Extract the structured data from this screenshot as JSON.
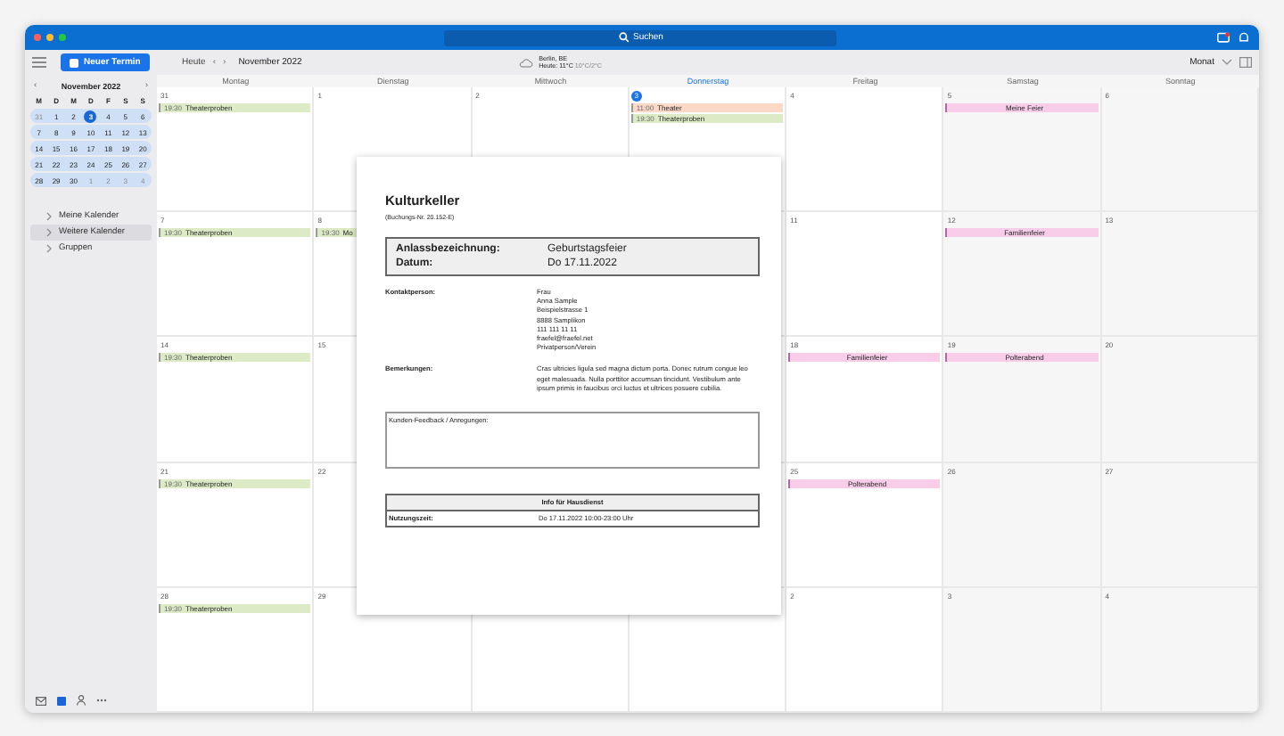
{
  "window": {
    "search": {
      "placeholder": "Suchen"
    }
  },
  "toolbar": {
    "new_button": "Neuer Termin",
    "today": "Heute",
    "prev": "‹",
    "next": "›",
    "period": "November 2022",
    "weather": {
      "city": "Berlin, BE",
      "today": "Heute: 11°C",
      "range": "10°C/2°C"
    },
    "view": "Monat"
  },
  "mini_calendar": {
    "title": "November 2022",
    "prev": "‹",
    "next": "›",
    "weekdays": [
      "M",
      "D",
      "M",
      "D",
      "F",
      "S",
      "S"
    ],
    "weeks": [
      [
        {
          "day": "31",
          "other": true,
          "selected": false
        },
        {
          "day": "1",
          "other": false,
          "selected": false
        },
        {
          "day": "2",
          "other": false,
          "selected": false
        },
        {
          "day": "3",
          "other": false,
          "selected": true
        },
        {
          "day": "4",
          "other": false,
          "selected": false
        },
        {
          "day": "5",
          "other": false,
          "selected": false
        },
        {
          "day": "6",
          "other": false,
          "selected": false
        }
      ],
      [
        {
          "day": "7",
          "other": false,
          "selected": false
        },
        {
          "day": "8",
          "other": false,
          "selected": false
        },
        {
          "day": "9",
          "other": false,
          "selected": false
        },
        {
          "day": "10",
          "other": false,
          "selected": false
        },
        {
          "day": "11",
          "other": false,
          "selected": false
        },
        {
          "day": "12",
          "other": false,
          "selected": false
        },
        {
          "day": "13",
          "other": false,
          "selected": false
        }
      ],
      [
        {
          "day": "14",
          "other": false,
          "selected": false
        },
        {
          "day": "15",
          "other": false,
          "selected": false
        },
        {
          "day": "16",
          "other": false,
          "selected": false
        },
        {
          "day": "17",
          "other": false,
          "selected": false
        },
        {
          "day": "18",
          "other": false,
          "selected": false
        },
        {
          "day": "19",
          "other": false,
          "selected": false
        },
        {
          "day": "20",
          "other": false,
          "selected": false
        }
      ],
      [
        {
          "day": "21",
          "other": false,
          "selected": false
        },
        {
          "day": "22",
          "other": false,
          "selected": false
        },
        {
          "day": "23",
          "other": false,
          "selected": false
        },
        {
          "day": "24",
          "other": false,
          "selected": false
        },
        {
          "day": "25",
          "other": false,
          "selected": false
        },
        {
          "day": "26",
          "other": false,
          "selected": false
        },
        {
          "day": "27",
          "other": false,
          "selected": false
        }
      ],
      [
        {
          "day": "28",
          "other": false,
          "selected": false
        },
        {
          "day": "29",
          "other": false,
          "selected": false
        },
        {
          "day": "30",
          "other": false,
          "selected": false
        },
        {
          "day": "1",
          "other": true,
          "selected": false
        },
        {
          "day": "2",
          "other": true,
          "selected": false
        },
        {
          "day": "3",
          "other": true,
          "selected": false
        },
        {
          "day": "4",
          "other": true,
          "selected": false
        }
      ]
    ]
  },
  "sidebar": {
    "items": [
      {
        "label": "Meine Kalender",
        "selected": false
      },
      {
        "label": "Weitere Kalender",
        "selected": true
      },
      {
        "label": "Gruppen",
        "selected": false
      }
    ]
  },
  "calendar": {
    "weekdays": [
      {
        "label": "Montag",
        "today": false
      },
      {
        "label": "Dienstag",
        "today": false
      },
      {
        "label": "Mittwoch",
        "today": false
      },
      {
        "label": "Donnerstag",
        "today": true
      },
      {
        "label": "Freitag",
        "today": false
      },
      {
        "label": "Samstag",
        "today": false
      },
      {
        "label": "Sonntag",
        "today": false
      }
    ],
    "weeks": [
      [
        {
          "day": "31",
          "today": false,
          "events": [
            {
              "kind": "timed",
              "time": "19:30",
              "title": "Theaterproben",
              "color": "#dcebc6"
            }
          ]
        },
        {
          "day": "1",
          "today": false
        },
        {
          "day": "2",
          "today": false
        },
        {
          "day": "3",
          "today": true,
          "events": [
            {
              "kind": "timed",
              "time": "11:00",
              "title": "Theater",
              "color": "#fbd9c6"
            },
            {
              "kind": "timed",
              "time": "19:30",
              "title": "Theaterproben",
              "color": "#dcebc6"
            }
          ]
        },
        {
          "day": "4",
          "today": false
        },
        {
          "day": "5",
          "today": false,
          "events": [
            {
              "kind": "allday",
              "title": "Meine Feier",
              "color": "#f7cde9"
            }
          ]
        },
        {
          "day": "6",
          "today": false
        }
      ],
      [
        {
          "day": "7",
          "today": false,
          "events": [
            {
              "kind": "timed",
              "time": "19:30",
              "title": "Theaterproben",
              "color": "#dcebc6"
            }
          ]
        },
        {
          "day": "8",
          "today": false,
          "events": [
            {
              "kind": "timed",
              "time": "19:30",
              "title": "Mo",
              "color": "#dcebc6"
            }
          ]
        },
        {
          "day": "11",
          "today": false
        },
        {
          "day": "12",
          "today": false,
          "events": [
            {
              "kind": "allday",
              "title": "Familienfeier",
              "color": "#f7cde9"
            }
          ]
        },
        {
          "day": "13",
          "today": false
        }
      ],
      [
        {
          "day": "14",
          "today": false,
          "events": [
            {
              "kind": "timed",
              "time": "19:30",
              "title": "Theaterproben",
              "color": "#dcebc6"
            }
          ]
        },
        {
          "day": "15",
          "today": false
        },
        {
          "day": "18",
          "today": false,
          "events": [
            {
              "kind": "allday",
              "title": "Familienfeier",
              "color": "#f7cde9"
            }
          ]
        },
        {
          "day": "19",
          "today": false,
          "events": [
            {
              "kind": "allday",
              "title": "Polterabend",
              "color": "#f7cde9"
            }
          ]
        },
        {
          "day": "20",
          "today": false
        }
      ],
      [
        {
          "day": "21",
          "today": false,
          "events": [
            {
              "kind": "timed",
              "time": "19:30",
              "title": "Theaterproben",
              "color": "#dcebc6"
            }
          ]
        },
        {
          "day": "22",
          "today": false
        },
        {
          "day": "25",
          "today": false,
          "events": [
            {
              "kind": "allday",
              "title": "Polterabend",
              "color": "#f7cde9"
            }
          ]
        },
        {
          "day": "26",
          "today": false
        },
        {
          "day": "27",
          "today": false
        }
      ],
      [
        {
          "day": "28",
          "today": false,
          "events": [
            {
              "kind": "timed",
              "time": "19:30",
              "title": "Theaterproben",
              "color": "#dcebc6"
            }
          ]
        },
        {
          "day": "29",
          "today": false
        },
        {
          "day": "2",
          "today": false
        },
        {
          "day": "3",
          "today": false
        },
        {
          "day": "4",
          "today": false
        }
      ]
    ]
  },
  "document": {
    "title": "Kulturkeller",
    "booking": "(Buchungs-Nr. 20.152-E)",
    "summary": [
      {
        "label": "Anlassbezeichnung:",
        "value": "Geburtstagsfeier"
      },
      {
        "label": "Datum:",
        "value": "Do 17.11.2022"
      }
    ],
    "contact_label": "Kontaktperson:",
    "contact_lines": [
      "Frau",
      "Anna Sample",
      "Beispielstrasse 1",
      "8888 Samplikon",
      "111 111 11 11",
      "fraefel@fraefel.net",
      "Privatperson/Verein"
    ],
    "remarks_label": "Bemerkungen:",
    "remarks": "Cras ultricies ligula sed magna dictum porta. Donec rutrum congue leo eget malesuada. Nulla porttitor accumsan tincidunt. Vestibulum ante ipsum primis in faucibus orci luctus et ultrices posuere cubilia.",
    "feedback_label": "Kunden-Feedback / Anregungen:",
    "info_title": "Info für Hausdienst",
    "info_label": "Nutzungszeit:",
    "info_value": "Do 17.11.2022 10:00-23:00 Uhr"
  }
}
